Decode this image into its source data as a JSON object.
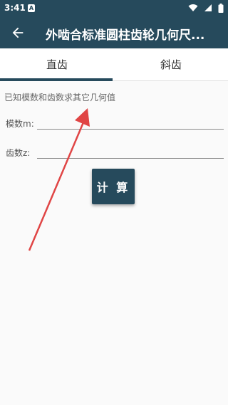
{
  "status_bar": {
    "time": "3:41",
    "notification_badge": "A"
  },
  "app_bar": {
    "back_icon": "arrow-left-icon",
    "title": "外啮合标准圆柱齿轮几何尺..."
  },
  "tabs": [
    {
      "label": "直齿",
      "selected": true
    },
    {
      "label": "斜齿",
      "selected": false
    }
  ],
  "form": {
    "hint": "已知模数和齿数求其它几何值",
    "fields": [
      {
        "label": "模数m:",
        "value": "",
        "placeholder": ""
      },
      {
        "label": "齿数z:",
        "value": "",
        "placeholder": ""
      }
    ],
    "calculate_label": "计 算"
  },
  "colors": {
    "primary": "#264a5c",
    "background": "#fafafa",
    "annotation_arrow": "#e04545"
  }
}
